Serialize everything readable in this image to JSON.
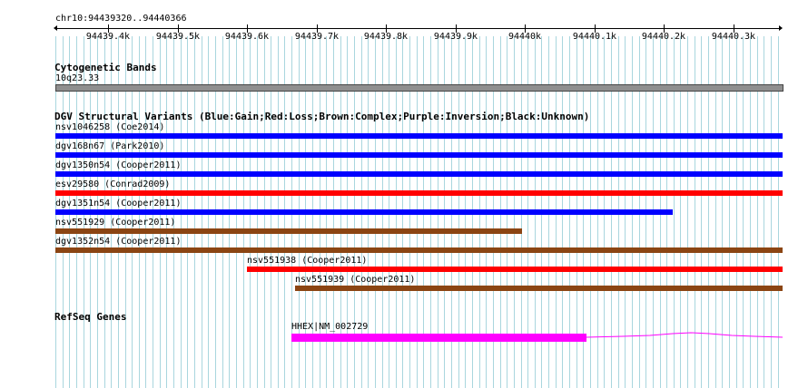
{
  "ruler": {
    "coordinate_label": "chr10:94439320..94440366",
    "ticks": [
      "94439.4k",
      "94439.5k",
      "94439.6k",
      "94439.7k",
      "94439.8k",
      "94439.9k",
      "94440k",
      "94440.1k",
      "94440.2k",
      "94440.3k"
    ]
  },
  "tracks": {
    "cytoband": {
      "title": "Cytogenetic Bands",
      "band_label": "10q23.33",
      "band_color": "#8f8f8f"
    },
    "dgv": {
      "title": "DGV Structural Variants (Blue:Gain;Red:Loss;Brown:Complex;Purple:Inversion;Black:Unknown)",
      "colors": {
        "gain": "#0000ff",
        "loss": "#ff0000",
        "complex": "#8b4513"
      },
      "variants": [
        {
          "label": "nsv1046258 (Coe2014)",
          "type": "gain"
        },
        {
          "label": "dgv168n67 (Park2010)",
          "type": "gain"
        },
        {
          "label": "dgv1350n54 (Cooper2011)",
          "type": "gain"
        },
        {
          "label": "esv29580 (Conrad2009)",
          "type": "loss"
        },
        {
          "label": "dgv1351n54 (Cooper2011)",
          "type": "gain"
        },
        {
          "label": "nsv551929 (Cooper2011)",
          "type": "complex"
        },
        {
          "label": "dgv1352n54 (Cooper2011)",
          "type": "complex"
        },
        {
          "label": "nsv551938 (Cooper2011)",
          "type": "loss"
        },
        {
          "label": "nsv551939 (Cooper2011)",
          "type": "complex"
        }
      ]
    },
    "refseq": {
      "title": "RefSeq Genes",
      "gene_label": "HHEX|NM_002729",
      "gene_color": "#ff00ff"
    }
  }
}
